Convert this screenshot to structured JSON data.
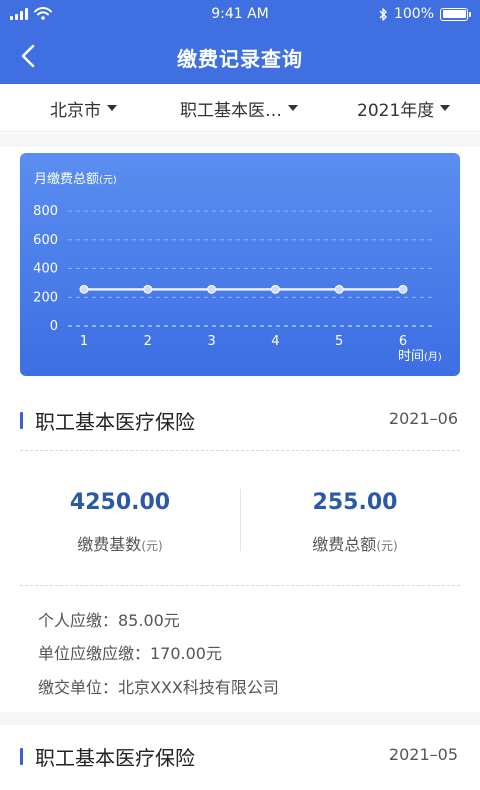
{
  "status_bar": {
    "time": "9:41 AM",
    "battery": "100%"
  },
  "header": {
    "title": "缴费记录查询"
  },
  "filters": [
    {
      "label": "北京市"
    },
    {
      "label": "职工基本医…"
    },
    {
      "label": "2021年度"
    }
  ],
  "chart_data": {
    "type": "line",
    "title": "月缴费总额",
    "title_unit": "(元)",
    "xlabel": "时间",
    "xlabel_unit": "(月)",
    "x": [
      1,
      2,
      3,
      4,
      5,
      6
    ],
    "values": [
      255,
      255,
      255,
      255,
      255,
      255
    ],
    "yticks": [
      0,
      200,
      400,
      600,
      800
    ],
    "ylim": [
      0,
      800
    ],
    "grid": true,
    "colors": {
      "line": "#e8f0ff",
      "point": "#cfdcf5",
      "grid": "#8fb1f3"
    }
  },
  "records": [
    {
      "title": "职工基本医疗保险",
      "date": "2021–06",
      "base_value": "4250.00",
      "base_label": "缴费基数",
      "base_unit": "(元)",
      "total_value": "255.00",
      "total_label": "缴费总额",
      "total_unit": "(元)",
      "personal": "个人应缴：85.00元",
      "company": "单位应缴应缴：170.00元",
      "employer": "缴交单位：北京XXX科技有限公司"
    },
    {
      "title": "职工基本医疗保险",
      "date": "2021–05"
    }
  ],
  "colors": {
    "brand": "#3f6fe0",
    "amount": "#2a59a8",
    "accent_bar": "#3464c8"
  },
  "icons": {
    "back": "chevron-left-icon",
    "wifi": "wifi-icon",
    "bluetooth": "bluetooth-icon",
    "battery": "battery-icon",
    "signal": "signal-icon"
  }
}
